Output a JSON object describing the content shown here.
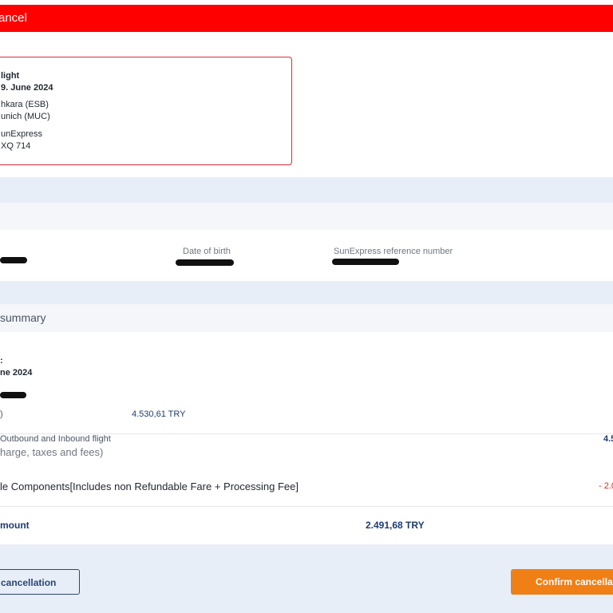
{
  "header": {
    "title": "ancel"
  },
  "flight_card": {
    "type": "light",
    "date": "9. June 2024",
    "origin": "hkara  (ESB)",
    "destination": "unich  (MUC)",
    "airline": "unExpress",
    "flight_number": "XQ 714"
  },
  "passenger": {
    "dob_label": "Date of birth",
    "reference_label": "SunExpress reference number"
  },
  "summary": {
    "title": "summary",
    "marker": ":",
    "date": "ne 2024",
    "base_label": ")",
    "base_amount": "4.530,61 TRY",
    "flight_label": "Outbound and Inbound flight",
    "flight_sublabel": "harge, taxes and fees)",
    "flight_amount": "4.5",
    "nonrefundable_label": "le Components[Includes non Refundable Fare + Processing Fee]",
    "nonrefundable_amount": "- 2.0",
    "refund_label": "mount",
    "refund_amount": "2.491,68 TRY"
  },
  "actions": {
    "keep_label": "cancellation",
    "confirm_label": "Confirm cancella"
  },
  "colors": {
    "header_red": "#ff0000",
    "accent_orange": "#f07f16",
    "navy": "#1f3b6e",
    "negative_red": "#e0261a"
  }
}
